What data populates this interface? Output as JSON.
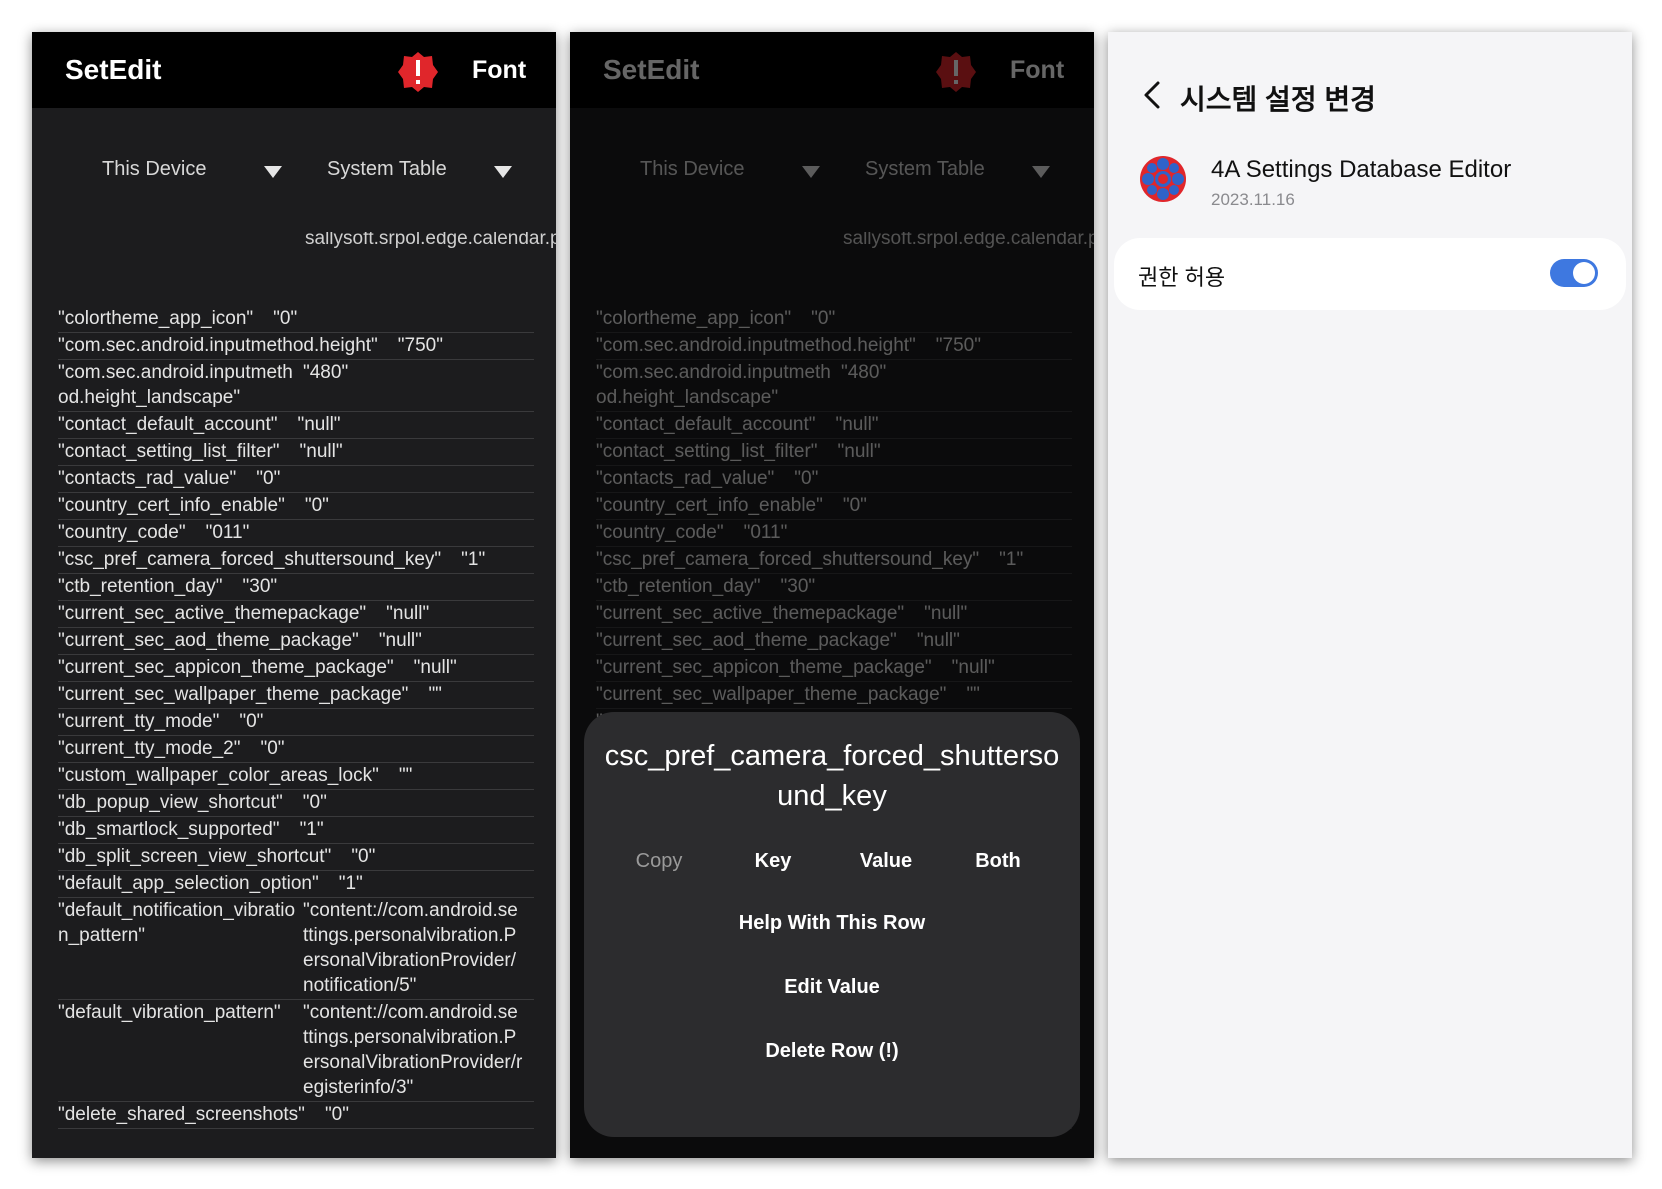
{
  "setedit": {
    "title": "SetEdit",
    "font_label": "Font",
    "device_dropdown": "This Device",
    "table_dropdown": "System Table",
    "partial_value": "sallysoft.srpol.edge.calendar.provider.CalendarPanelProvider;com.sec.andro",
    "rows": [
      {
        "key": "\"colortheme_app_icon\"",
        "value": "\"0\""
      },
      {
        "key": "\"com.sec.android.inputmethod.height\"",
        "value": "\"750\""
      },
      {
        "key": "\"com.sec.android.inputmethod.height_landscape\"",
        "value": "\"480\""
      },
      {
        "key": "\"contact_default_account\"",
        "value": "\"null\""
      },
      {
        "key": "\"contact_setting_list_filter\"",
        "value": "\"null\""
      },
      {
        "key": "\"contacts_rad_value\"",
        "value": "\"0\""
      },
      {
        "key": "\"country_cert_info_enable\"",
        "value": "\"0\""
      },
      {
        "key": "\"country_code\"",
        "value": "\"011\""
      },
      {
        "key": "\"csc_pref_camera_forced_shuttersound_key\"",
        "value": "\"1\""
      },
      {
        "key": "\"ctb_retention_day\"",
        "value": "\"30\""
      },
      {
        "key": "\"current_sec_active_themepackage\"",
        "value": "\"null\""
      },
      {
        "key": "\"current_sec_aod_theme_package\"",
        "value": "\"null\""
      },
      {
        "key": "\"current_sec_appicon_theme_package\"",
        "value": "\"null\""
      },
      {
        "key": "\"current_sec_wallpaper_theme_package\"",
        "value": "\"\""
      },
      {
        "key": "\"current_tty_mode\"",
        "value": "\"0\""
      },
      {
        "key": "\"current_tty_mode_2\"",
        "value": "\"0\""
      },
      {
        "key": "\"custom_wallpaper_color_areas_lock\"",
        "value": "\"\""
      },
      {
        "key": "\"db_popup_view_shortcut\"",
        "value": "\"0\""
      },
      {
        "key": "\"db_smartlock_supported\"",
        "value": "\"1\""
      },
      {
        "key": "\"db_split_screen_view_shortcut\"",
        "value": "\"0\""
      },
      {
        "key": "\"default_app_selection_option\"",
        "value": "\"1\""
      },
      {
        "key": "\"default_notification_vibration_pattern\"",
        "value": "\"content://com.android.settings.personalvibration.PersonalVibrationProvider/notification/5\""
      },
      {
        "key": "\"default_vibration_pattern\"",
        "value": "\"content://com.android.settings.personalvibration.PersonalVibrationProvider/registerinfo/3\""
      },
      {
        "key": "\"delete_shared_screenshots\"",
        "value": "\"0\""
      }
    ]
  },
  "dialog": {
    "title": "csc_pref_camera_forced_shuttersound_key",
    "copy_label": "Copy",
    "copy_key": "Key",
    "copy_value": "Value",
    "copy_both": "Both",
    "help": "Help With This Row",
    "edit": "Edit Value",
    "delete": "Delete Row (!)"
  },
  "settings": {
    "title": "시스템 설정 변경",
    "app_name": "4A Settings Database Editor",
    "app_date": "2023.11.16",
    "permission_label": "권한 허용",
    "toggle_on": true,
    "accent": "#3e78e0"
  },
  "colors": {
    "warn_red": "#e0262b",
    "icon_blue": "#2f63c9"
  }
}
